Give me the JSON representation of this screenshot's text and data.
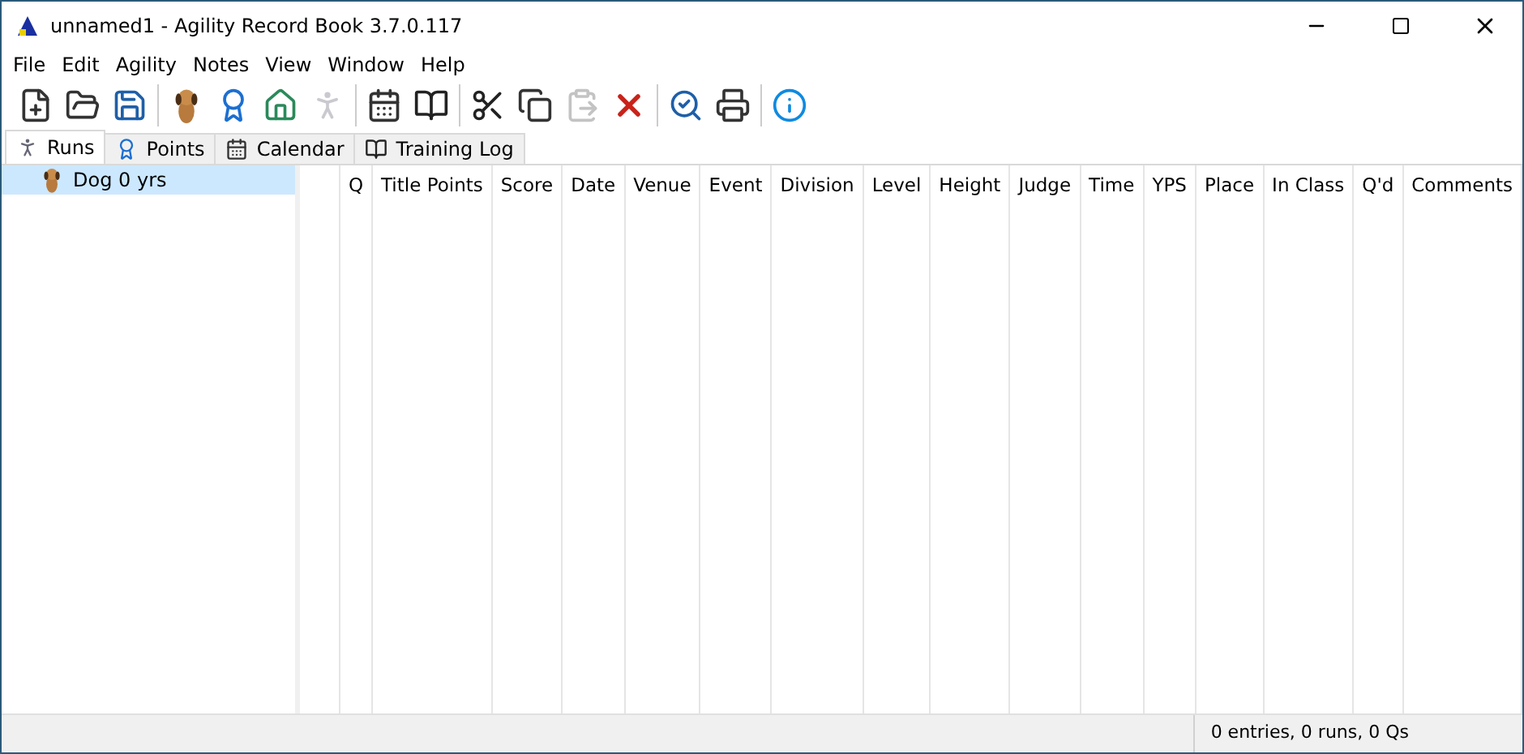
{
  "window": {
    "title": "unnamed1 - Agility Record Book 3.7.0.117"
  },
  "menu": [
    "File",
    "Edit",
    "Agility",
    "Notes",
    "View",
    "Window",
    "Help"
  ],
  "toolbar": [
    [
      {
        "kind": "new",
        "disabled": false
      },
      {
        "kind": "open",
        "disabled": false
      },
      {
        "kind": "save",
        "disabled": false
      }
    ],
    [
      {
        "kind": "dog",
        "disabled": false
      },
      {
        "kind": "ribbon",
        "disabled": false
      },
      {
        "kind": "title",
        "disabled": false
      },
      {
        "kind": "run",
        "disabled": true
      }
    ],
    [
      {
        "kind": "calendar",
        "disabled": false
      },
      {
        "kind": "book",
        "disabled": false
      }
    ],
    [
      {
        "kind": "cut",
        "disabled": false
      },
      {
        "kind": "copy",
        "disabled": false
      },
      {
        "kind": "paste",
        "disabled": true
      },
      {
        "kind": "delete",
        "disabled": false
      }
    ],
    [
      {
        "kind": "preview",
        "disabled": false
      },
      {
        "kind": "print",
        "disabled": false
      }
    ],
    [
      {
        "kind": "info",
        "disabled": false
      }
    ]
  ],
  "tabs": [
    {
      "label": "Runs",
      "kind": "run",
      "selected": true
    },
    {
      "label": "Points",
      "kind": "ribbon",
      "selected": false
    },
    {
      "label": "Calendar",
      "kind": "calendar",
      "selected": false
    },
    {
      "label": "Training Log",
      "kind": "book",
      "selected": false
    }
  ],
  "tree": [
    {
      "label": "Dog 0 yrs",
      "selected": true
    }
  ],
  "table": {
    "columns": [
      "Q",
      "Title Points",
      "Score",
      "Date",
      "Venue",
      "Event",
      "Division",
      "Level",
      "Height",
      "Judge",
      "Time",
      "YPS",
      "Place",
      "In Class",
      "Q'd",
      "Comments"
    ]
  },
  "status_bar": "0 entries, 0 runs, 0 Qs"
}
